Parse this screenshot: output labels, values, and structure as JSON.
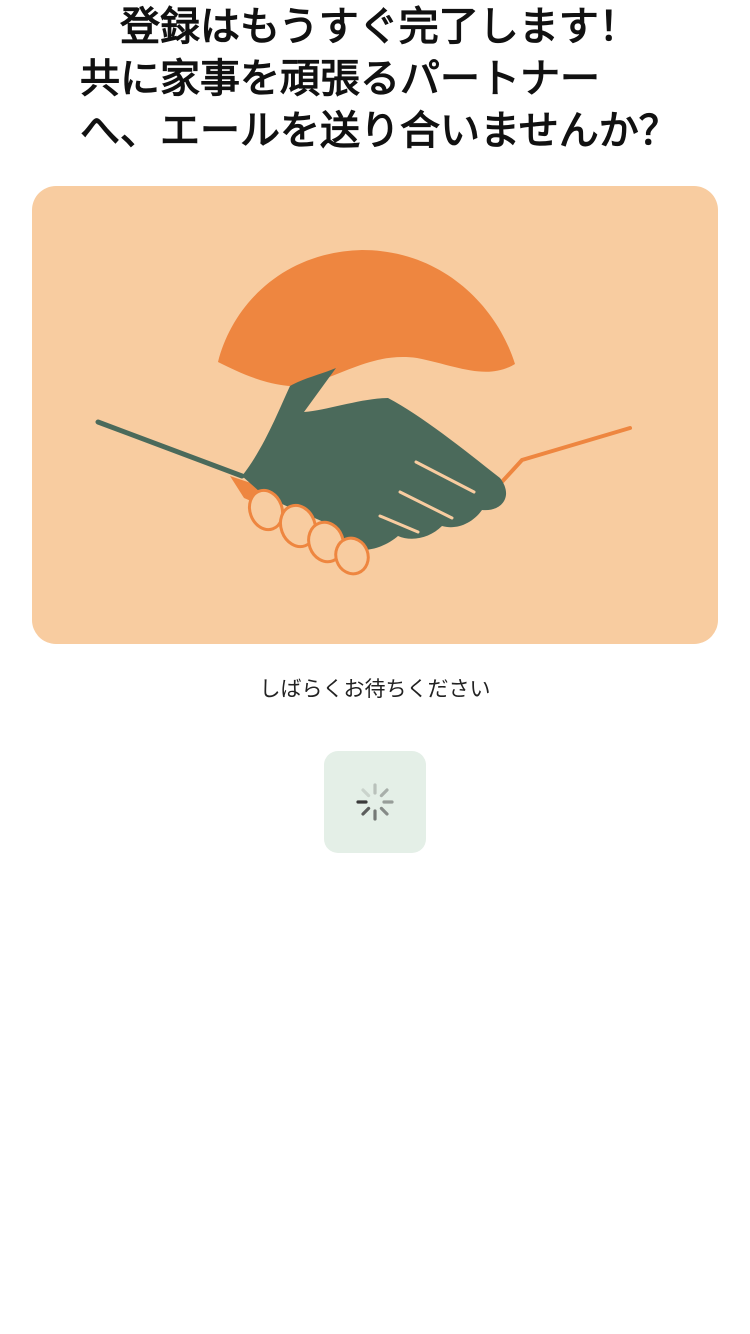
{
  "headline": {
    "line1": "登録はもうすぐ完了します！",
    "line2": "共に家事を頑張るパートナー",
    "line3": "へ、エールを送り合いませんか？"
  },
  "illustration": {
    "subject": "handshake",
    "colors": {
      "background": "#f8cca0",
      "sun": "#ee8640",
      "dark_hand": "#4b6a5b",
      "light_hand": "#f8cca0",
      "outline": "#ee8640"
    }
  },
  "status": {
    "wait_text": "しばらくお待ちください"
  },
  "spinner": {
    "icon": "loading-spinner-icon",
    "background": "#e4efe7",
    "color": "#3b3b3b"
  }
}
